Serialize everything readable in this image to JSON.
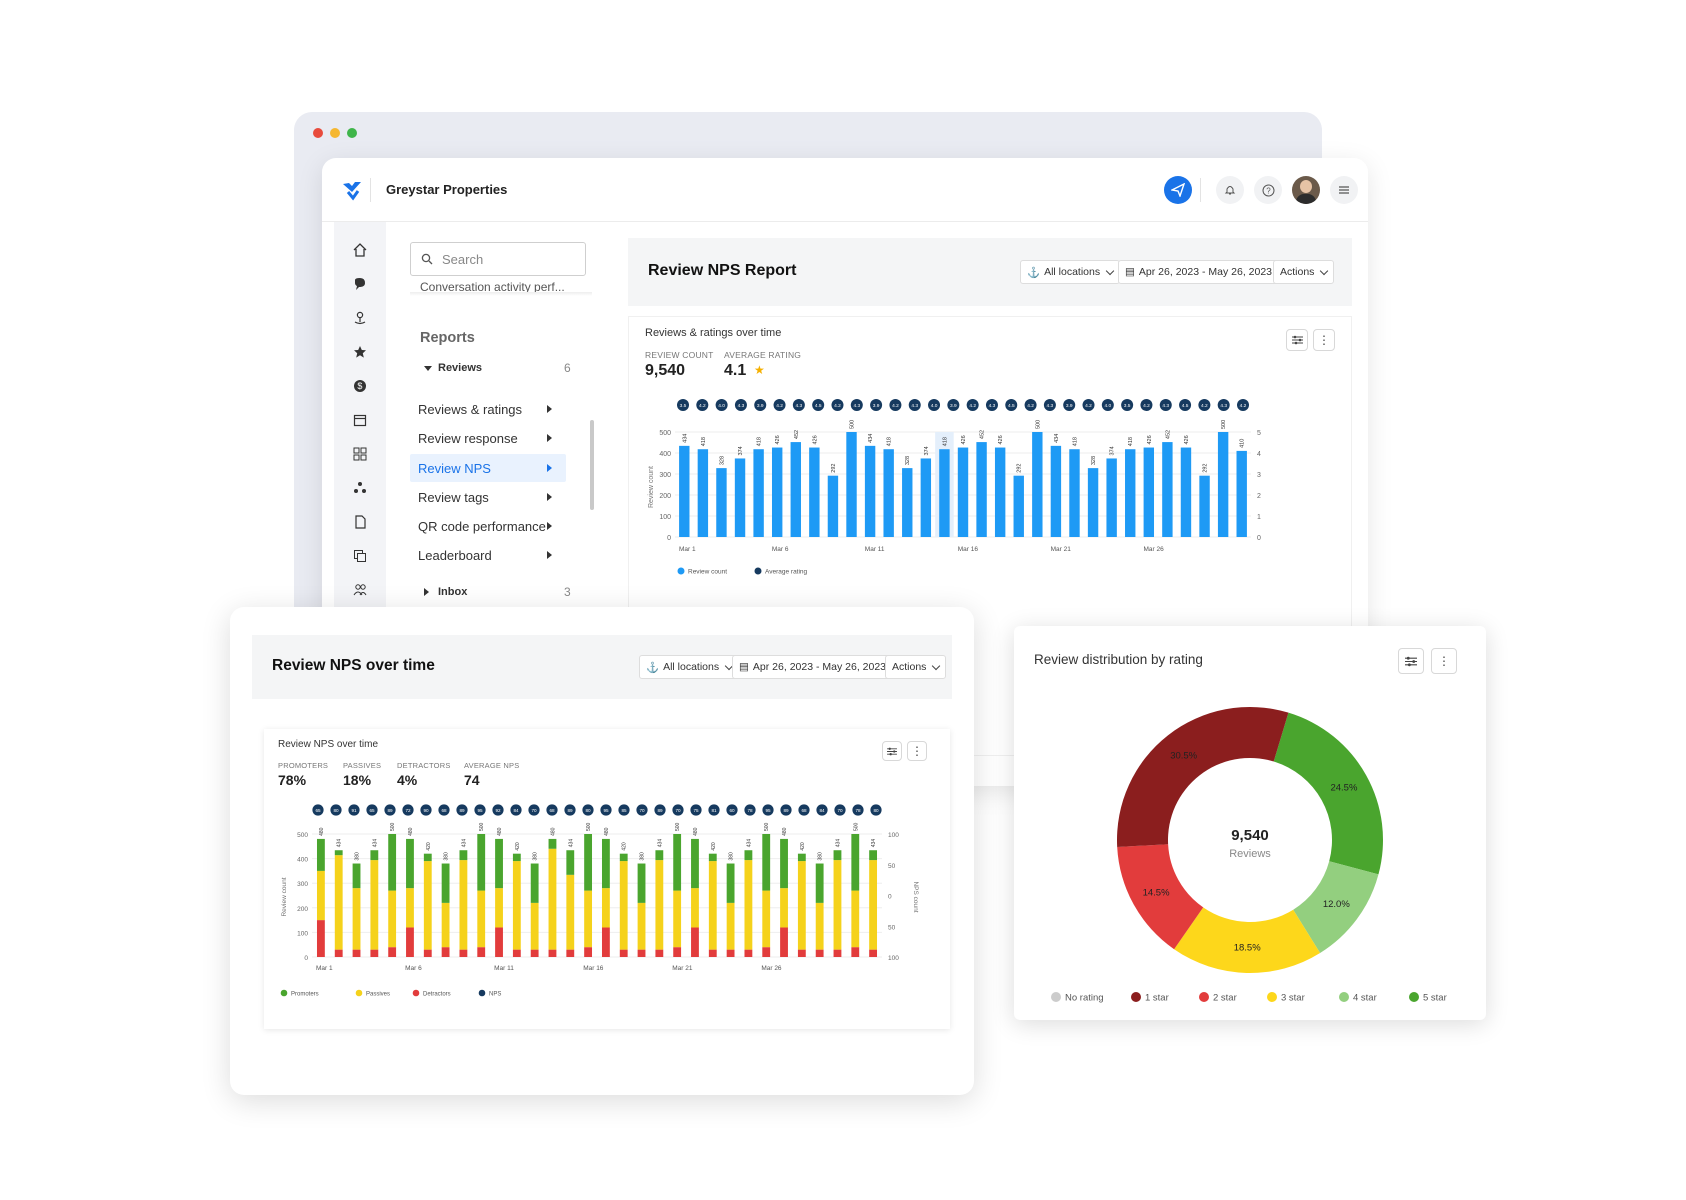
{
  "app": {
    "org_name": "Greystar Properties"
  },
  "colors": {
    "accent": "#1a73e8",
    "bar_blue": "#1e9af5",
    "nps_navy": "#163a5f",
    "promoters": "#4aa52e",
    "passives": "#f5d21b",
    "detractors": "#e23c3c",
    "dark_red": "#8b1e1e",
    "light_green": "#93cf7f",
    "no_rating": "#cccccc"
  },
  "header_icons": [
    "send-icon",
    "bell-icon",
    "help-icon",
    "avatar",
    "menu-icon"
  ],
  "sidebar": {
    "search_placeholder": "Search",
    "truncated_item": "Conversation activity perf...",
    "section_title": "Reports",
    "group": {
      "label": "Reviews",
      "count": "6"
    },
    "items": [
      {
        "label": "Reviews & ratings"
      },
      {
        "label": "Review response"
      },
      {
        "label": "Review NPS"
      },
      {
        "label": "Review tags"
      },
      {
        "label": "QR code performance"
      },
      {
        "label": "Leaderboard"
      }
    ],
    "inbox": {
      "label": "Inbox",
      "count": "3"
    }
  },
  "report": {
    "title": "Review NPS Report",
    "locations": "All locations",
    "date_range": "Apr 26, 2023  -  May 26, 2023",
    "actions": "Actions"
  },
  "ratings_card": {
    "title": "Reviews & ratings over time",
    "review_count_label": "REVIEW COUNT",
    "review_count": "9,540",
    "avg_rating_label": "AVERAGE RATING",
    "avg_rating": "4.1",
    "ylabel": "Review count",
    "legend": [
      "Review count",
      "Average rating"
    ]
  },
  "nps_panel": {
    "title": "Review NPS over time",
    "locations": "All locations",
    "date_range": "Apr 26, 2023  -  May 26, 2023",
    "actions": "Actions",
    "card_title": "Review NPS over time",
    "stats": [
      {
        "label": "PROMOTERS",
        "value": "78%"
      },
      {
        "label": "PASSIVES",
        "value": "18%"
      },
      {
        "label": "DETRACTORS",
        "value": "4%"
      },
      {
        "label": "AVERAGE NPS",
        "value": "74"
      }
    ],
    "ylabel": "Review count",
    "y2label": "NPS count",
    "legend": [
      "Promoters",
      "Passives",
      "Detractors",
      "NPS"
    ]
  },
  "distribution": {
    "title": "Review distribution by rating",
    "center_value": "9,540",
    "center_label": "Reviews"
  },
  "chart_data": [
    {
      "type": "bar",
      "title": "Reviews & ratings over time",
      "ylabel": "Review count",
      "ylim": [
        0,
        500
      ],
      "y2lim": [
        0,
        5
      ],
      "yticks": [
        "500",
        "400",
        "300",
        "200",
        "100",
        "0"
      ],
      "y2ticks": [
        "5",
        "4",
        "3",
        "2",
        "1",
        "0"
      ],
      "xticks": [
        {
          "label": "Mar 1",
          "index": 0
        },
        {
          "label": "Mar 6",
          "index": 5
        },
        {
          "label": "Mar 11",
          "index": 10
        },
        {
          "label": "Mar 16",
          "index": 15
        },
        {
          "label": "Mar 21",
          "index": 20
        },
        {
          "label": "Mar 26",
          "index": 25
        }
      ],
      "highlight_index": 14,
      "series": [
        {
          "name": "Review count",
          "values": [
            434,
            418,
            328,
            374,
            418,
            426,
            452,
            426,
            292,
            500,
            434,
            418,
            328,
            374,
            418,
            426,
            452,
            426,
            292,
            500,
            434,
            418,
            328,
            374,
            418,
            426,
            452,
            426,
            292,
            500,
            410
          ]
        },
        {
          "name": "Average rating",
          "values": [
            "3.5",
            "4.2",
            "4.0",
            "4.3",
            "3.9",
            "4.2",
            "4.3",
            "4.5",
            "4.2",
            "4.3",
            "3.9",
            "4.2",
            "4.3",
            "4.0",
            "3.9",
            "4.2",
            "4.3",
            "4.5",
            "4.2",
            "4.3",
            "3.9",
            "4.2",
            "4.0",
            "3.5",
            "4.2",
            "4.3",
            "4.5",
            "4.2",
            "4.3",
            "4.2"
          ]
        }
      ],
      "legend": [
        "Review count",
        "Average rating"
      ]
    },
    {
      "type": "bar",
      "stacked": true,
      "title": "Review NPS over time",
      "ylabel": "Review count",
      "y2label": "NPS count",
      "ylim": [
        0,
        500
      ],
      "y2lim": [
        -100,
        100
      ],
      "yticks": [
        "500",
        "400",
        "300",
        "200",
        "100",
        "0"
      ],
      "y2ticks": [
        "100",
        "50",
        "0",
        "50",
        "100"
      ],
      "xticks": [
        {
          "label": "Mar 1",
          "index": 0
        },
        {
          "label": "Mar 6",
          "index": 5
        },
        {
          "label": "Mar 11",
          "index": 10
        },
        {
          "label": "Mar 16",
          "index": 15
        },
        {
          "label": "Mar 21",
          "index": 20
        },
        {
          "label": "Mar 26",
          "index": 25
        }
      ],
      "totals": [
        480,
        434,
        380,
        434,
        500,
        480,
        420,
        380,
        434,
        500,
        480,
        420,
        380,
        480,
        434,
        500,
        480,
        420,
        380,
        434,
        500,
        480,
        420,
        380,
        434,
        500,
        480,
        420,
        380,
        434,
        500,
        434
      ],
      "series": [
        {
          "name": "Promoters",
          "values": [
            130,
            20,
            100,
            40,
            230,
            200,
            30,
            160,
            40,
            230,
            200,
            30,
            160,
            40,
            100,
            230,
            200,
            30,
            160,
            40,
            230,
            200,
            30,
            160,
            40,
            230,
            200,
            30,
            160,
            40,
            230,
            40
          ]
        },
        {
          "name": "Passives",
          "values": [
            200,
            384,
            250,
            364,
            230,
            160,
            360,
            180,
            364,
            230,
            160,
            360,
            190,
            410,
            304,
            230,
            160,
            360,
            190,
            364,
            230,
            160,
            360,
            190,
            364,
            230,
            160,
            360,
            190,
            364,
            230,
            364
          ]
        },
        {
          "name": "Detractors",
          "values": [
            150,
            30,
            30,
            30,
            40,
            120,
            30,
            40,
            30,
            40,
            120,
            30,
            30,
            30,
            30,
            40,
            120,
            30,
            30,
            30,
            40,
            120,
            30,
            30,
            30,
            40,
            120,
            30,
            30,
            30,
            40,
            30
          ]
        },
        {
          "name": "NPS",
          "values": [
            "65",
            "80",
            "91",
            "65",
            "89",
            "72",
            "90",
            "68",
            "89",
            "95",
            "92",
            "84",
            "70",
            "68",
            "89",
            "80",
            "95",
            "85",
            "70",
            "89",
            "70",
            "75",
            "81",
            "60",
            "78",
            "95",
            "89",
            "68",
            "84",
            "70",
            "78",
            "80"
          ]
        }
      ],
      "legend": [
        "Promoters",
        "Passives",
        "Detractors",
        "NPS"
      ]
    },
    {
      "type": "pie",
      "donut": true,
      "title": "Review distribution by rating",
      "categories": [
        "No rating",
        "1 star",
        "2 star",
        "3 star",
        "4 star",
        "5 star"
      ],
      "values": [
        0,
        30.5,
        14.5,
        18.5,
        12.0,
        24.5
      ],
      "labels": [
        "",
        "30.5%",
        "14.5%",
        "18.5%",
        "12.0%",
        "24.5%"
      ],
      "colors": [
        "#cccccc",
        "#8b1e1e",
        "#e23c3c",
        "#fdd71b",
        "#93cf7f",
        "#4aa52e"
      ],
      "legend_position": "bottom"
    }
  ]
}
